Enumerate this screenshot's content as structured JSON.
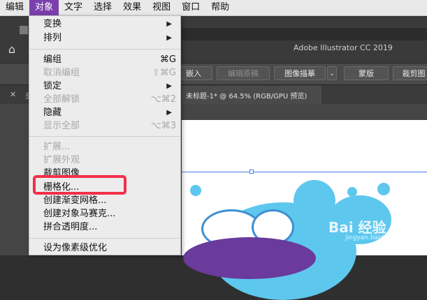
{
  "menubar": {
    "items": [
      "编辑",
      "对象",
      "文字",
      "选择",
      "效果",
      "视图",
      "窗口",
      "帮助"
    ],
    "active_index": 1
  },
  "app": {
    "title": "Adobe Illustrator CC 2019"
  },
  "controlbar": {
    "embed": "嵌入",
    "edit_original": "编辑原稿",
    "image_trace": "图像描摹",
    "mask": "蒙版",
    "crop": "裁剪图"
  },
  "tabs": {
    "inactive_label": "头",
    "active_label": "未标题-1* @ 64.5% (RGB/GPU 预览)"
  },
  "object_menu": {
    "items": [
      {
        "label": "变换",
        "submenu": true,
        "disabled": false
      },
      {
        "label": "排列",
        "submenu": true,
        "disabled": false
      },
      {
        "label": "编组",
        "shortcut": "⌘G",
        "disabled": false
      },
      {
        "label": "取消编组",
        "shortcut": "⇧⌘G",
        "disabled": true
      },
      {
        "label": "锁定",
        "submenu": true,
        "disabled": false
      },
      {
        "label": "全部解锁",
        "shortcut": "⌥⌘2",
        "disabled": true
      },
      {
        "label": "隐藏",
        "submenu": true,
        "disabled": false
      },
      {
        "label": "显示全部",
        "shortcut": "⌥⌘3",
        "disabled": true
      },
      {
        "label": "扩展...",
        "disabled": true
      },
      {
        "label": "扩展外观",
        "disabled": true
      },
      {
        "label": "裁剪图像",
        "disabled": false
      },
      {
        "label": "栅格化...",
        "disabled": false,
        "highlighted": true
      },
      {
        "label": "创建渐变网格...",
        "disabled": false
      },
      {
        "label": "创建对象马赛克...",
        "disabled": false
      },
      {
        "label": "拼合透明度...",
        "disabled": false
      },
      {
        "label": "设为像素级优化",
        "disabled": false
      }
    ]
  },
  "watermark": {
    "brand": "Bai 经验",
    "url": "jingyan.baidu.com"
  },
  "colors": {
    "menu_active": "#7b3fae",
    "highlight": "#f2304a",
    "art_blue": "#5ec7ee",
    "art_purple": "#6a3a9c"
  }
}
